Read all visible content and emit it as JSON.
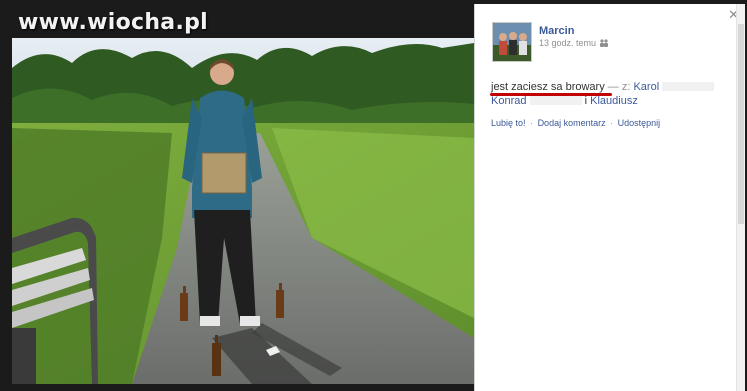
{
  "watermark": {
    "text": "www.wiocha.pl"
  },
  "post": {
    "author": "Marcin",
    "time": "13 godz. temu",
    "privacy_icon": "people-icon",
    "status_text": "jest zaciesz sa browary",
    "with_separator": "— z:",
    "tagged_1": "Karol",
    "tagged_2": "Konrad",
    "tagged_conjunction": "i",
    "tagged_3": "Klaudiusz"
  },
  "actions": {
    "like": "Lubię to!",
    "comment": "Dodaj komentarz",
    "share": "Udostępnij",
    "separator": "·"
  },
  "ui": {
    "close_glyph": "✕"
  },
  "colors": {
    "link": "#3b5998",
    "highlight_underline": "#c30000",
    "panel_bg": "#ffffff",
    "page_bg": "#1b1b1b"
  }
}
